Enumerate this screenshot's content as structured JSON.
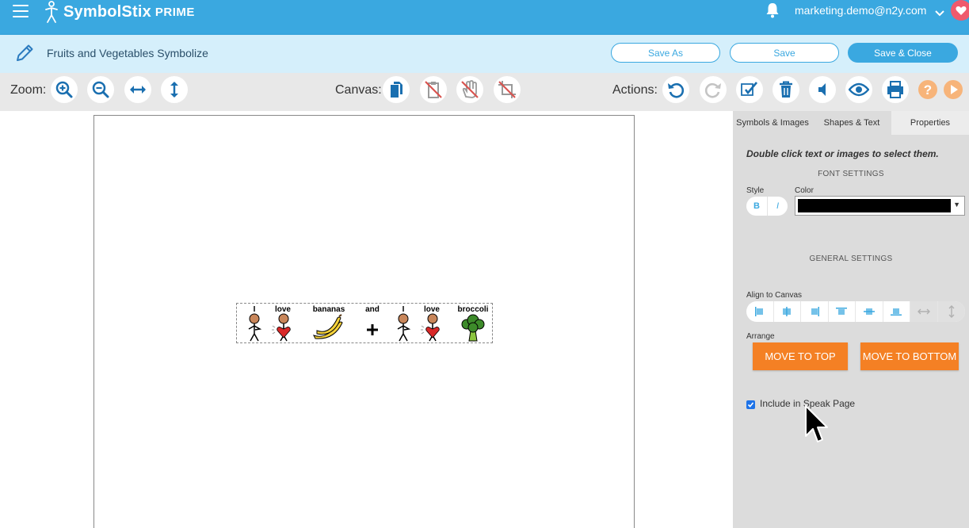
{
  "app": {
    "name": "SymbolStix",
    "edition": "PRIME"
  },
  "user": {
    "email": "marketing.demo@n2y.com"
  },
  "document": {
    "title": "Fruits and Vegetables Symbolize"
  },
  "titlebar": {
    "save_as_label": "Save As",
    "save_label": "Save",
    "save_close_label": "Save & Close"
  },
  "toolbar": {
    "zoom_label": "Zoom:",
    "canvas_label": "Canvas:",
    "actions_label": "Actions:",
    "zoom_icons": [
      "zoom-in-icon",
      "zoom-out-icon",
      "fit-width-icon",
      "fit-height-icon"
    ],
    "canvas_icons": [
      "copy-icon",
      "paste-icon",
      "pan-icon",
      "crop-icon"
    ],
    "action_icons": [
      "undo-icon",
      "redo-icon",
      "symbolize-icon",
      "trash-icon",
      "speak-icon",
      "preview-icon",
      "print-icon",
      "help-icon",
      "play-icon"
    ]
  },
  "canvas": {
    "symbols": [
      {
        "word": "I",
        "icon": "person-pointing-self-icon"
      },
      {
        "word": "love",
        "icon": "person-hugging-heart-icon"
      },
      {
        "word": "bananas",
        "icon": "bananas-icon"
      },
      {
        "word": "and",
        "icon": "plus-icon"
      },
      {
        "word": "I",
        "icon": "person-pointing-self-icon"
      },
      {
        "word": "love",
        "icon": "person-hugging-heart-icon"
      },
      {
        "word": "broccoli",
        "icon": "broccoli-icon"
      }
    ]
  },
  "panel": {
    "tabs": [
      {
        "label": "Symbols & Images",
        "active": false
      },
      {
        "label": "Shapes & Text",
        "active": false
      },
      {
        "label": "Properties",
        "active": true
      }
    ],
    "hint": "Double click text or images to select them.",
    "font_settings_heading": "FONT SETTINGS",
    "style_label": "Style",
    "bold_label": "B",
    "italic_label": "I",
    "color_label": "Color",
    "selected_color": "#000000",
    "general_settings_heading": "GENERAL SETTINGS",
    "align_label": "Align to Canvas",
    "align_icons": [
      "align-left-icon",
      "align-center-horizontal-icon",
      "align-right-icon",
      "align-top-icon",
      "align-middle-vertical-icon",
      "align-bottom-icon",
      "distribute-horizontal-icon",
      "distribute-vertical-icon"
    ],
    "arrange_label": "Arrange",
    "move_top_label": "MOVE TO TOP",
    "move_bottom_label": "MOVE TO BOTTOM",
    "include_speak_label": "Include in Speak Page",
    "include_speak_checked": true
  },
  "colors": {
    "brand_blue": "#3aa8e0",
    "title_bar": "#d5effb",
    "toolbar_bg": "#e8e8e8",
    "panel_bg": "#dcdcdc",
    "orange": "#f48024",
    "disabled_red": "#d9534f"
  }
}
